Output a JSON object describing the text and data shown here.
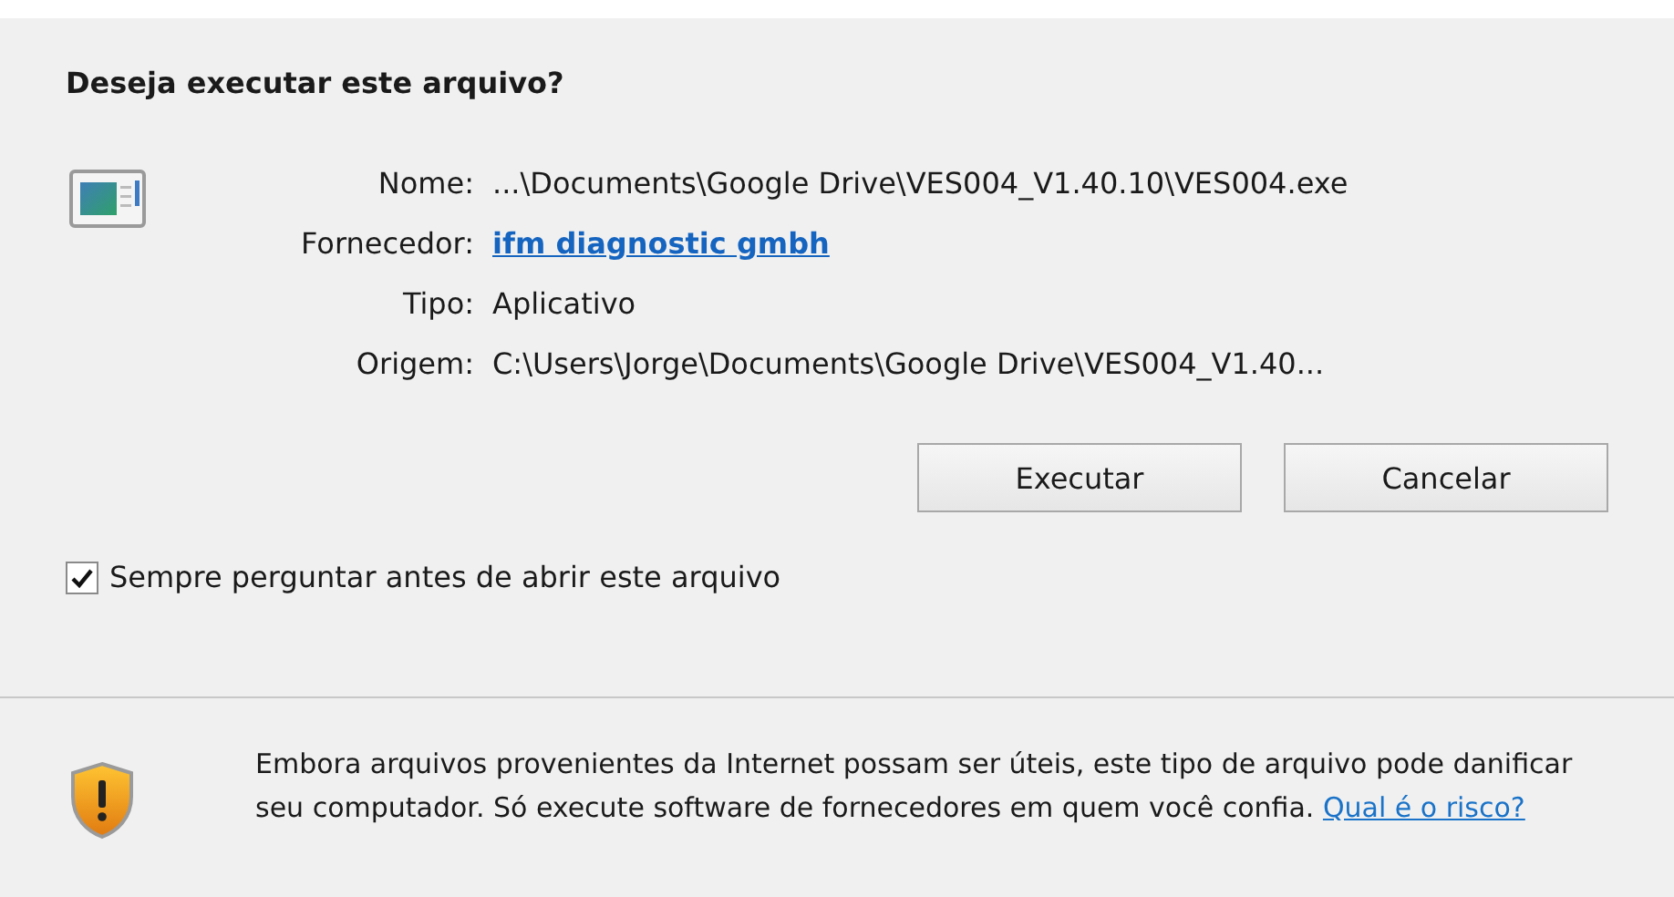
{
  "title": "Deseja executar este arquivo?",
  "fields": [
    {
      "label": "Nome:",
      "value": "...\\Documents\\Google Drive\\VES004_V1.40.10\\VES004.exe",
      "kind": "text"
    },
    {
      "label": "Fornecedor:",
      "value": "ifm diagnostic gmbh",
      "kind": "link"
    },
    {
      "label": "Tipo:",
      "value": "Aplicativo",
      "kind": "text"
    },
    {
      "label": "Origem:",
      "value": "C:\\Users\\Jorge\\Documents\\Google Drive\\VES004_V1.40...",
      "kind": "text"
    }
  ],
  "buttons": [
    "Executar",
    "Cancelar"
  ],
  "checkbox": {
    "label": "Sempre perguntar antes de abrir este arquivo",
    "checked": true
  },
  "warning": {
    "text": "Embora arquivos provenientes da Internet possam ser úteis, este tipo de arquivo pode danificar seu computador. Só execute software de fornecedores em quem você confia.",
    "link": "Qual é o risco?"
  }
}
